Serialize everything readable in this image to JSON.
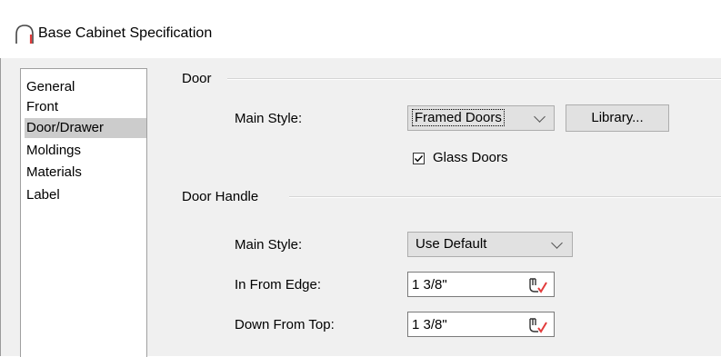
{
  "window": {
    "title": "Base Cabinet Specification",
    "icon": "arch-icon",
    "icon_color": "#e23b3b"
  },
  "nav": {
    "items": [
      {
        "label": "General",
        "selected": false
      },
      {
        "label": "Front",
        "selected": false
      },
      {
        "label": "Door/Drawer",
        "selected": true
      },
      {
        "label": "Moldings",
        "selected": false
      },
      {
        "label": "Materials",
        "selected": false
      },
      {
        "label": "Label",
        "selected": false
      }
    ]
  },
  "door": {
    "group_title": "Door",
    "main_style_label": "Main Style:",
    "main_style_value": "Framed Doors",
    "library_button": "Library...",
    "glass_doors_label": "Glass Doors",
    "glass_doors_checked": true
  },
  "door_handle": {
    "group_title": "Door Handle",
    "main_style_label": "Main Style:",
    "main_style_value": "Use Default",
    "in_from_edge_label": "In From Edge:",
    "in_from_edge_value": "1 3/8\"",
    "down_from_top_label": "Down From Top:",
    "down_from_top_value": "1 3/8\"",
    "field_icon": "dimension-picker-icon"
  }
}
